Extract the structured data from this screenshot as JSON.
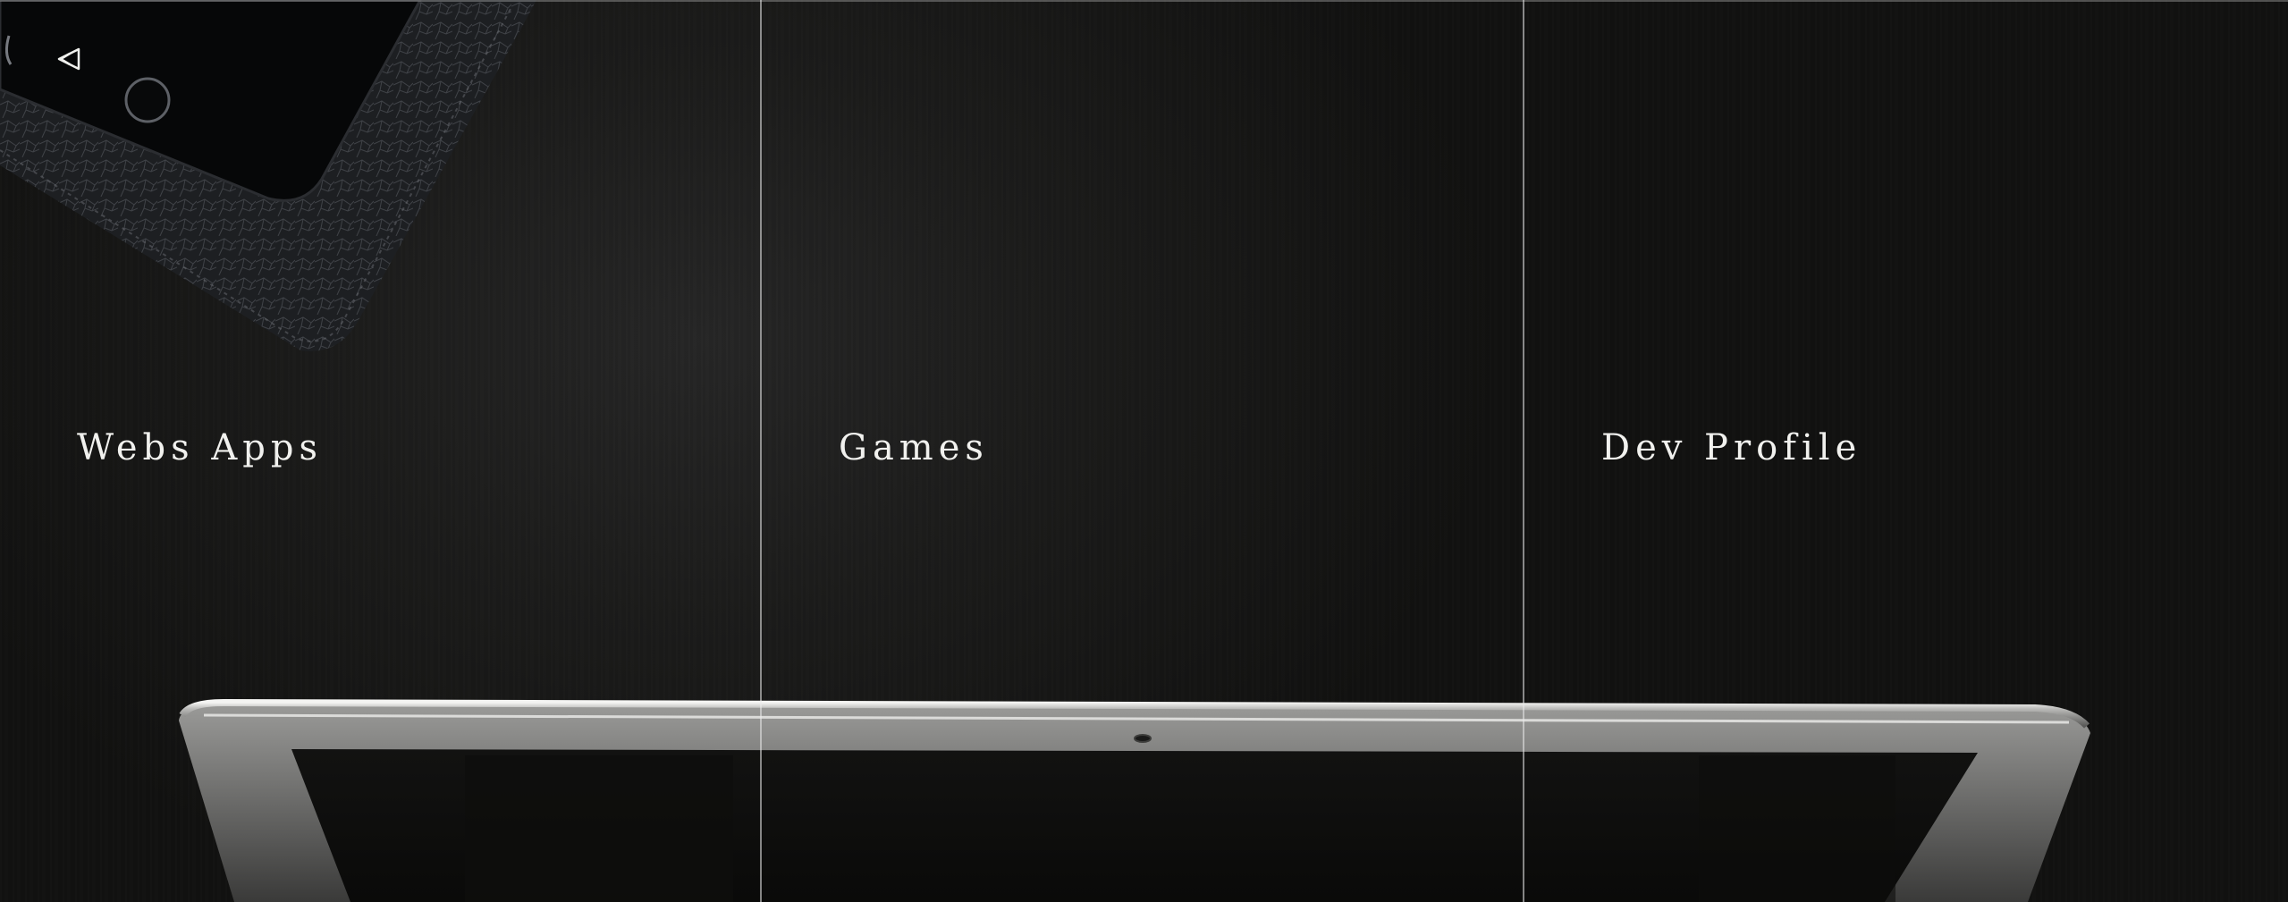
{
  "nav": {
    "back_icon": "rewind-icon"
  },
  "panels": [
    {
      "label": "Webs Apps"
    },
    {
      "label": "Games"
    },
    {
      "label": "Dev Profile"
    }
  ],
  "colors": {
    "label_text": "#f1f1ee",
    "divider": "#ebebeb",
    "background": "#141413"
  }
}
